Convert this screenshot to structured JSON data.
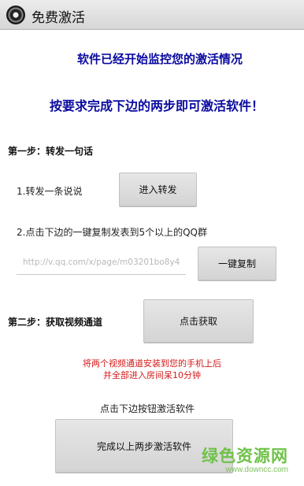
{
  "titlebar": {
    "title": "免费激活",
    "icon": "app-camera-icon"
  },
  "headlines": {
    "line1": "软件已经开始监控您的激活情况",
    "line2": "按要求完成下边的两步即可激活软件！"
  },
  "step1": {
    "title": "第一步：转发一句话",
    "item1_label": "1.转发一条说说",
    "forward_button": "进入转发",
    "item2_label": "2.点击下边的一键复制发表到5个以上的QQ群",
    "url_placeholder": "http://v.qq.com/x/page/m03201bo8y4",
    "copy_button": "一键复制"
  },
  "step2": {
    "title": "第二步：获取视频通道",
    "get_button": "点击获取",
    "note_line1": "将两个视频通道安装到您的手机上后",
    "note_line2": "并全部进入房间呆10分钟"
  },
  "activate": {
    "prompt": "点击下边按钮激活软件",
    "button": "完成以上两步激活软件"
  },
  "watermark": {
    "name": "绿色资源网",
    "url": "www.downcc.com"
  },
  "colors": {
    "headline": "#0a0aa0",
    "note": "#d41818",
    "watermark": "#6fc24a"
  }
}
